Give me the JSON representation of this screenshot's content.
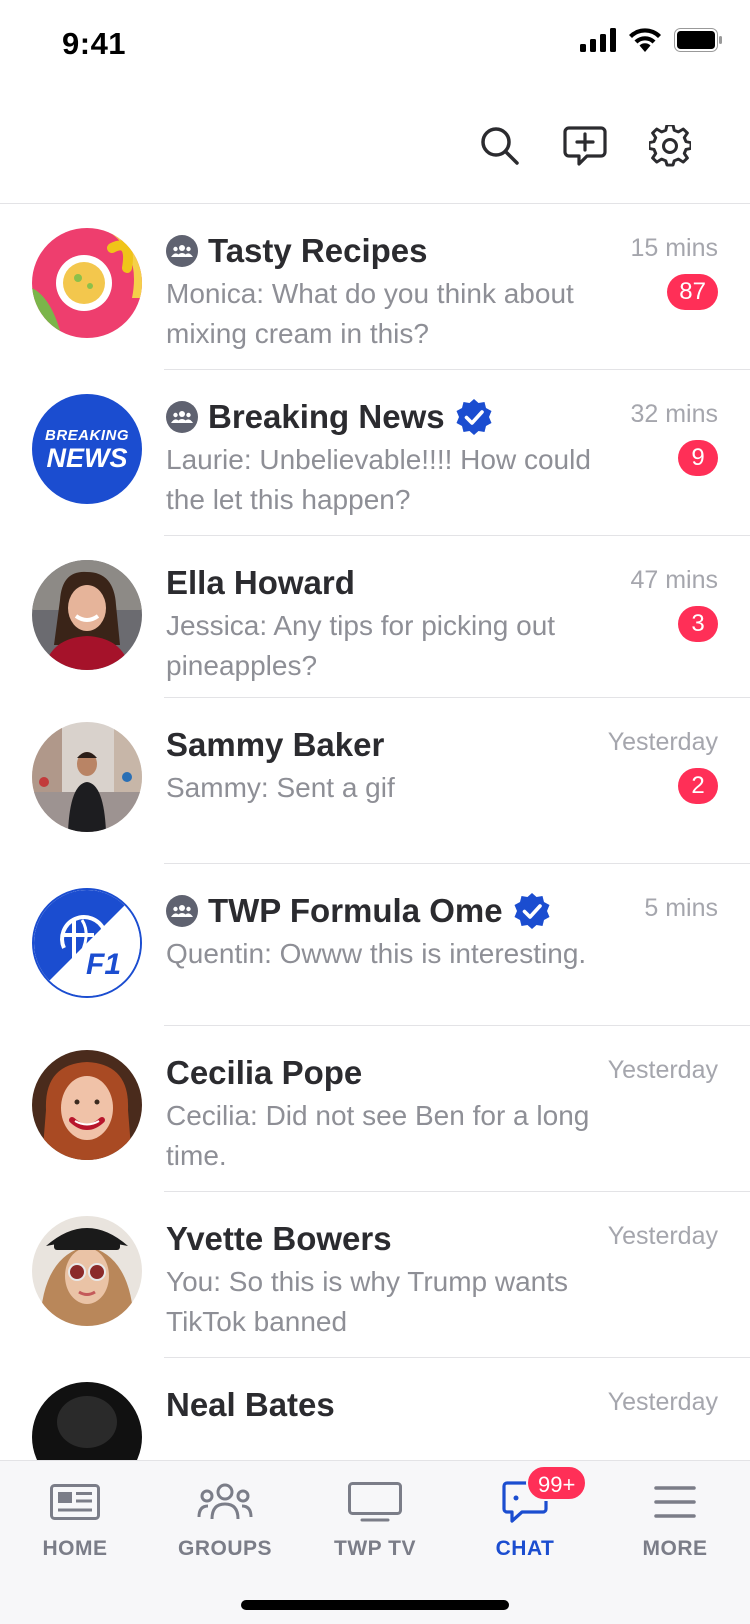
{
  "status_bar": {
    "time": "9:41"
  },
  "colors": {
    "accent": "#1b4dd0",
    "badge": "#ff2f57",
    "muted": "#8e8f96",
    "separator": "#e3e3e6"
  },
  "header": {
    "icons": [
      "search-icon",
      "new-chat-icon",
      "settings-icon"
    ]
  },
  "chats": [
    {
      "name": "Tasty Recipes",
      "group": true,
      "verified": false,
      "time": "15 mins",
      "message": "Monica: What do you think about mixing cream in this?",
      "unread": "87"
    },
    {
      "name": "Breaking News",
      "group": true,
      "verified": true,
      "time": "32 mins",
      "message": "Laurie: Unbelievable!!!! How could the let this happen?",
      "unread": "9",
      "avatar_text": [
        "BREAKING",
        "NEWS"
      ]
    },
    {
      "name": "Ella Howard",
      "group": false,
      "verified": false,
      "time": "47 mins",
      "message": "Jessica: Any tips for picking out pineapples?",
      "unread": "3"
    },
    {
      "name": "Sammy Baker",
      "group": false,
      "verified": false,
      "time": "Yesterday",
      "message": "Sammy: Sent a gif",
      "unread": "2"
    },
    {
      "name": "TWP Formula Ome",
      "group": true,
      "verified": true,
      "time": "5 mins",
      "message": "Quentin: Owww this is interesting.",
      "unread": "",
      "avatar_text": [
        "F1"
      ]
    },
    {
      "name": "Cecilia Pope",
      "group": false,
      "verified": false,
      "time": "Yesterday",
      "message": "Cecilia: Did not see Ben for a long time.",
      "unread": ""
    },
    {
      "name": "Yvette Bowers",
      "group": false,
      "verified": false,
      "time": "Yesterday",
      "message": "You: So this is why Trump wants TikTok banned",
      "unread": ""
    },
    {
      "name": "Neal Bates",
      "group": false,
      "verified": false,
      "time": "Yesterday",
      "message": "",
      "unread": ""
    }
  ],
  "tabs": [
    {
      "label": "HOME",
      "icon": "news-icon",
      "active": false
    },
    {
      "label": "GROUPS",
      "icon": "groups-icon",
      "active": false
    },
    {
      "label": "TWP TV",
      "icon": "tv-icon",
      "active": false
    },
    {
      "label": "CHAT",
      "icon": "chat-icon",
      "active": true,
      "badge": "99+"
    },
    {
      "label": "MORE",
      "icon": "menu-icon",
      "active": false
    }
  ]
}
